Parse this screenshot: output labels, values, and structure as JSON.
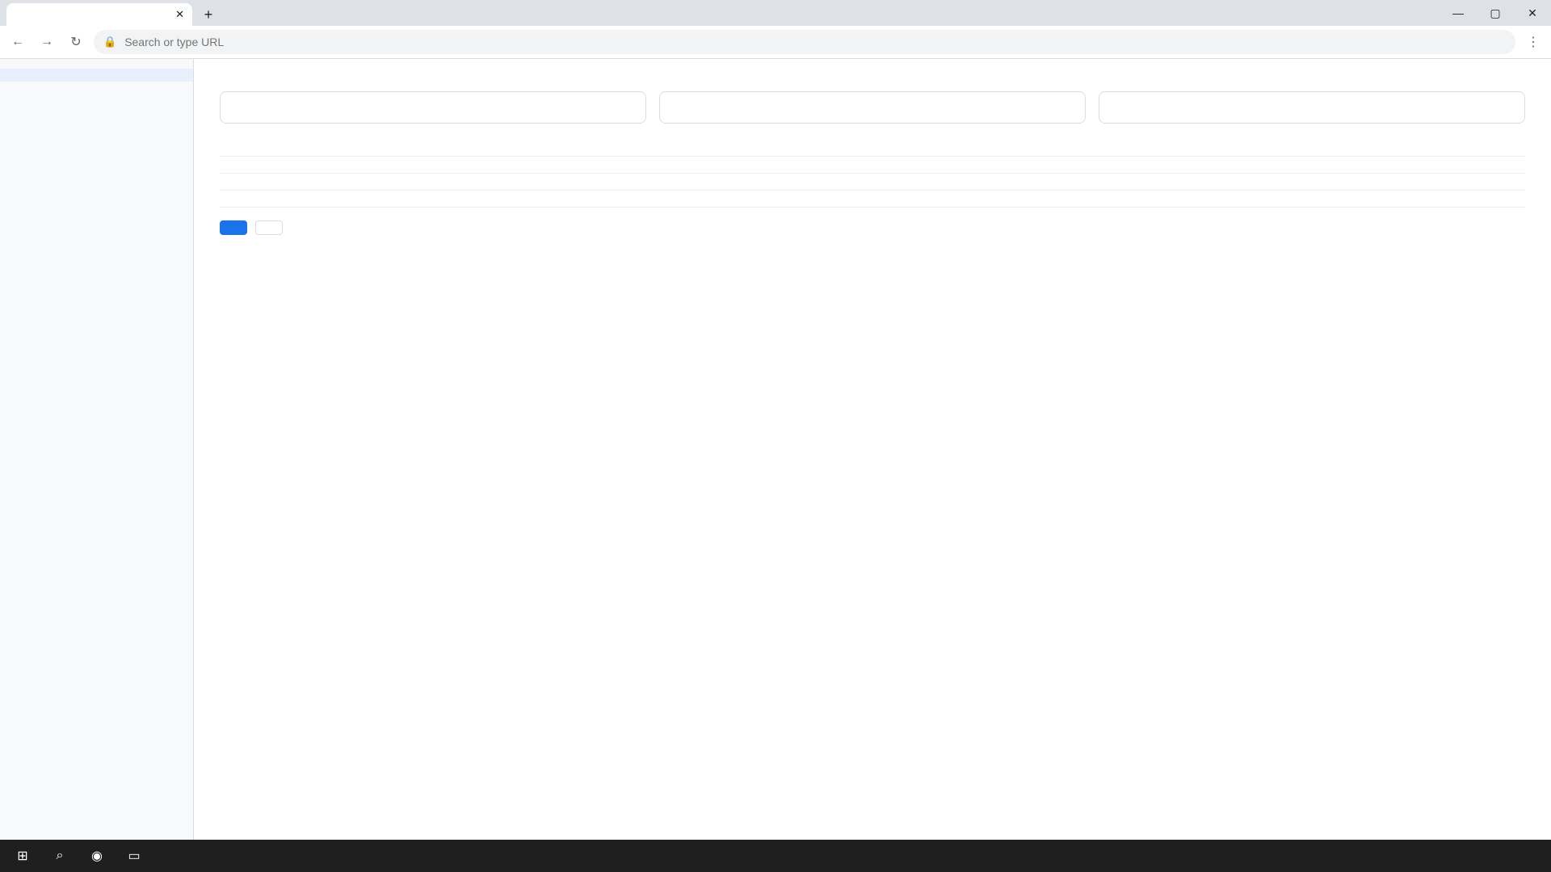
{
  "browser": {
    "tab_label": "",
    "new_tab": "+",
    "url": "",
    "url_placeholder": "Search or type URL"
  },
  "sidebar": {
    "items": [
      {
        "label": ""
      },
      {
        "label": ""
      },
      {
        "label": ""
      },
      {
        "label": ""
      }
    ]
  },
  "main": {
    "title": "",
    "cards": [
      {
        "title": "",
        "value": ""
      },
      {
        "title": "",
        "value": ""
      },
      {
        "title": "",
        "value": ""
      }
    ],
    "table": {
      "headers": [
        "",
        "",
        ""
      ],
      "rows": [
        [
          "",
          "",
          ""
        ],
        [
          "",
          "",
          ""
        ],
        [
          "",
          "",
          ""
        ]
      ]
    },
    "primary_button": "",
    "secondary_button": ""
  },
  "taskbar": {
    "time": "",
    "date": ""
  },
  "icons": {
    "back": "back-arrow-icon",
    "forward": "forward-arrow-icon",
    "reload": "reload-icon",
    "lock": "lock-icon",
    "start": "windows-start-icon"
  }
}
